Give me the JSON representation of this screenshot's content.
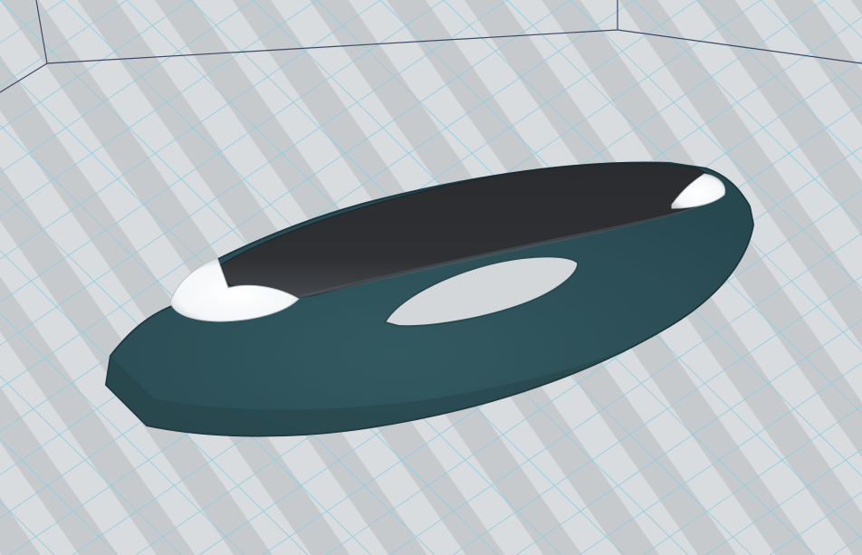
{
  "scene": {
    "colors": {
      "floor_light": "#dcdfe2",
      "floor_dark": "#c6c9cd",
      "grid_line": "#8fcde0",
      "boundary_line": "#3c4a6a",
      "body": "#2c4d53",
      "body_highlight": "#3a5f66",
      "cockpit": "#2b2d30",
      "cockpit_sheen": "#4a4d52",
      "light_white": "#ffffff",
      "outline": "#1f3840"
    },
    "objects": [
      {
        "name": "floor-grid",
        "type": "grid"
      },
      {
        "name": "hovercraft-model",
        "type": "mesh"
      }
    ]
  }
}
